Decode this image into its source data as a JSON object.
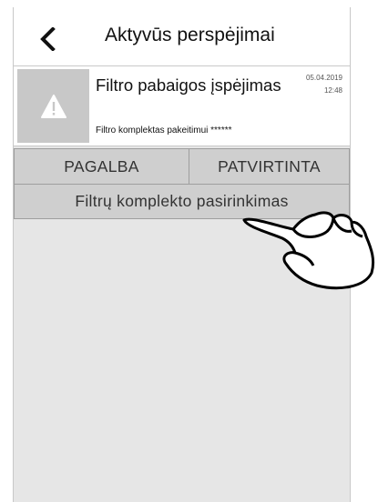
{
  "header": {
    "title": "Aktyvūs perspėjimai",
    "back_icon": "chevron-left-icon"
  },
  "alert": {
    "icon": "warning-triangle-icon",
    "title": "Filtro pabaigos įspėjimas",
    "date": "05.04.2019",
    "time": "12:48",
    "detail": "Filtro komplektas pakeitimui ******"
  },
  "actions": {
    "help_label": "PAGALBA",
    "confirm_label": "PATVIRTINTA",
    "filter_set_label": "Filtrų komplekto pasirinkimas"
  },
  "overlay": {
    "icon": "pointing-hand-icon"
  },
  "colors": {
    "screen_bg": "#e6e6e6",
    "button_bg": "#cfcfcf",
    "icon_box_bg": "#c8c8c8",
    "header_bg": "#ffffff"
  }
}
